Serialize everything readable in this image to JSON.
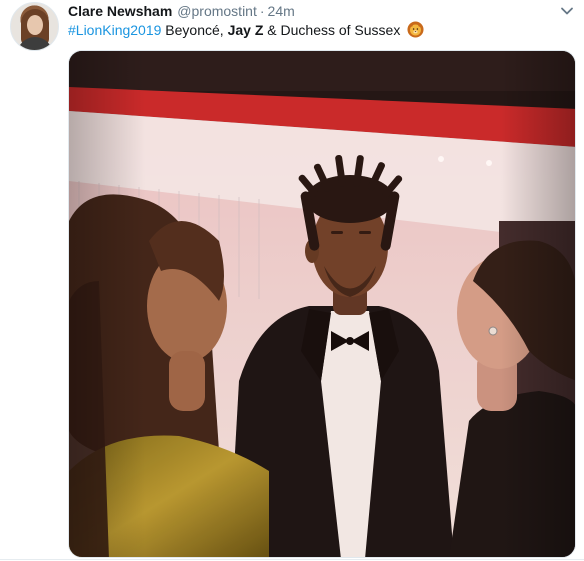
{
  "tweet": {
    "author_name": "Clare Newsham",
    "handle": "@promostint",
    "separator": "·",
    "time": "24m",
    "text": {
      "hashtag": "#LionKing2019",
      "part1": " Beyoncé, ",
      "bold": "Jay Z",
      "part2": " & Duchess of Sussex "
    }
  },
  "icons": {
    "menu": "chevron-down-icon",
    "emoji": "lion-face-icon"
  },
  "colors": {
    "link": "#1b95e0",
    "name": "#14171a",
    "secondary": "#657786"
  }
}
